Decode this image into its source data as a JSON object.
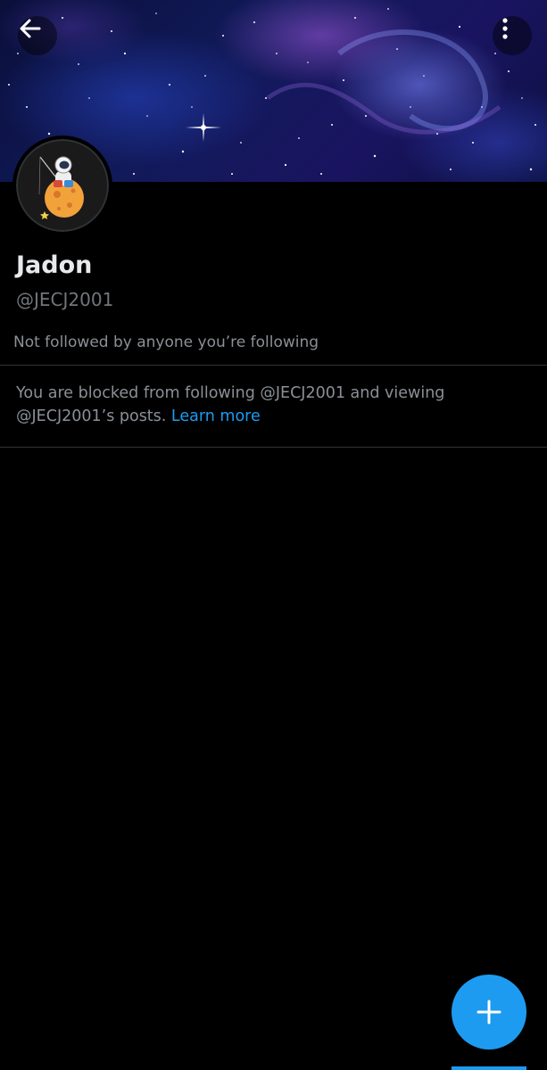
{
  "header": {
    "back_icon": "arrow-left-icon",
    "more_icon": "vertical-ellipsis-icon"
  },
  "profile": {
    "display_name": "Jadon",
    "handle": "@JECJ2001",
    "followed_by": "Not followed by anyone you’re following",
    "avatar_icon": "astronaut-on-planet-avatar"
  },
  "blocked_notice": {
    "text": "You are blocked from following @JECJ2001 and viewing @JECJ2001’s posts. ",
    "link_label": "Learn more"
  },
  "fab": {
    "icon": "plus-icon"
  },
  "colors": {
    "background": "#000000",
    "accent": "#1d9bf0",
    "primary_text": "#e7e9ea",
    "secondary_text": "#71767b",
    "divider": "#2f3336"
  }
}
